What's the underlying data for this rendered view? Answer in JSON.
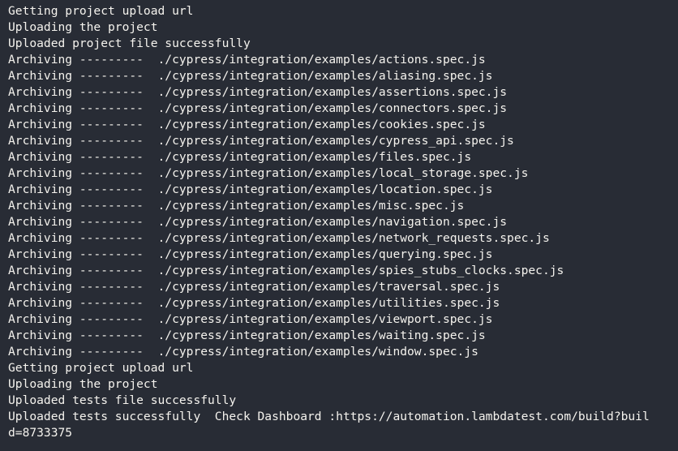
{
  "terminal": {
    "background_color": "#282c35",
    "text_color": "#f5f3ee",
    "font_size_px": 14.6,
    "line_height_px": 20,
    "archive_separator": "---------",
    "lines": [
      {
        "text": "Getting project upload url"
      },
      {
        "text": "Uploading the project"
      },
      {
        "text": "Uploaded project file successfully"
      },
      {
        "text": "Archiving ---------  ./cypress/integration/examples/actions.spec.js"
      },
      {
        "text": "Archiving ---------  ./cypress/integration/examples/aliasing.spec.js"
      },
      {
        "text": "Archiving ---------  ./cypress/integration/examples/assertions.spec.js"
      },
      {
        "text": "Archiving ---------  ./cypress/integration/examples/connectors.spec.js"
      },
      {
        "text": "Archiving ---------  ./cypress/integration/examples/cookies.spec.js"
      },
      {
        "text": "Archiving ---------  ./cypress/integration/examples/cypress_api.spec.js"
      },
      {
        "text": "Archiving ---------  ./cypress/integration/examples/files.spec.js"
      },
      {
        "text": "Archiving ---------  ./cypress/integration/examples/local_storage.spec.js"
      },
      {
        "text": "Archiving ---------  ./cypress/integration/examples/location.spec.js"
      },
      {
        "text": "Archiving ---------  ./cypress/integration/examples/misc.spec.js"
      },
      {
        "text": "Archiving ---------  ./cypress/integration/examples/navigation.spec.js"
      },
      {
        "text": "Archiving ---------  ./cypress/integration/examples/network_requests.spec.js"
      },
      {
        "text": "Archiving ---------  ./cypress/integration/examples/querying.spec.js"
      },
      {
        "text": "Archiving ---------  ./cypress/integration/examples/spies_stubs_clocks.spec.js"
      },
      {
        "text": "Archiving ---------  ./cypress/integration/examples/traversal.spec.js"
      },
      {
        "text": "Archiving ---------  ./cypress/integration/examples/utilities.spec.js"
      },
      {
        "text": "Archiving ---------  ./cypress/integration/examples/viewport.spec.js"
      },
      {
        "text": "Archiving ---------  ./cypress/integration/examples/waiting.spec.js"
      },
      {
        "text": "Archiving ---------  ./cypress/integration/examples/window.spec.js"
      },
      {
        "text": "Getting project upload url"
      },
      {
        "text": "Uploading the project"
      },
      {
        "text": "Uploaded tests file successfully"
      },
      {
        "text": "Uploaded tests successfully  Check Dashboard :https://automation.lambdatest.com/build?buil"
      },
      {
        "text": "d=8733375"
      }
    ],
    "dashboard_url": "https://automation.lambdatest.com/build?build=8733375",
    "build_id": "8733375",
    "archived_files": [
      "actions.spec.js",
      "aliasing.spec.js",
      "assertions.spec.js",
      "connectors.spec.js",
      "cookies.spec.js",
      "cypress_api.spec.js",
      "files.spec.js",
      "local_storage.spec.js",
      "location.spec.js",
      "misc.spec.js",
      "navigation.spec.js",
      "network_requests.spec.js",
      "querying.spec.js",
      "spies_stubs_clocks.spec.js",
      "traversal.spec.js",
      "utilities.spec.js",
      "viewport.spec.js",
      "waiting.spec.js",
      "window.spec.js"
    ],
    "archive_base_path": "./cypress/integration/examples/"
  }
}
